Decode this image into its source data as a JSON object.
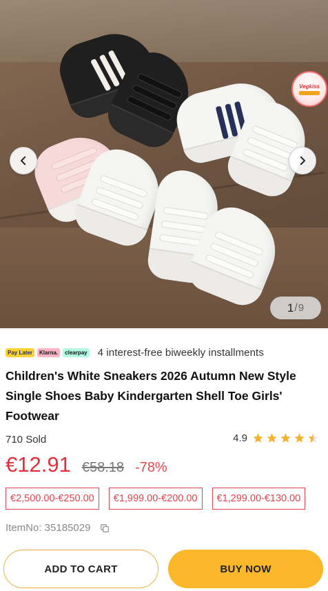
{
  "gallery": {
    "counter_current": "1",
    "counter_separator": "/",
    "counter_total": "9",
    "badge_text": "Vegkiss"
  },
  "installments": {
    "logos": [
      "Pay Later",
      "Klarna.",
      "clearpay"
    ],
    "text": "4 interest-free biweekly installments"
  },
  "product": {
    "title": "Children's White Sneakers 2026 Autumn New Style Single Shoes Baby Kindergarten Shell Toe Girls' Footwear",
    "sold": "710 Sold",
    "rating": "4.9",
    "rating_stars": 4.5,
    "price": "€12.91",
    "old_price": "€58.18",
    "discount": "-78%",
    "tiers": [
      "€2,500.00-€250.00",
      "€1,999.00-€200.00",
      "€1,299.00-€130.00"
    ],
    "item_no": "ItemNo: 35185029"
  },
  "actions": {
    "add_to_cart": "ADD TO CART",
    "buy_now": "BUY NOW"
  },
  "colors": {
    "price": "#e52e3a",
    "accent": "#fbb82a",
    "star": "#f6b22a"
  }
}
